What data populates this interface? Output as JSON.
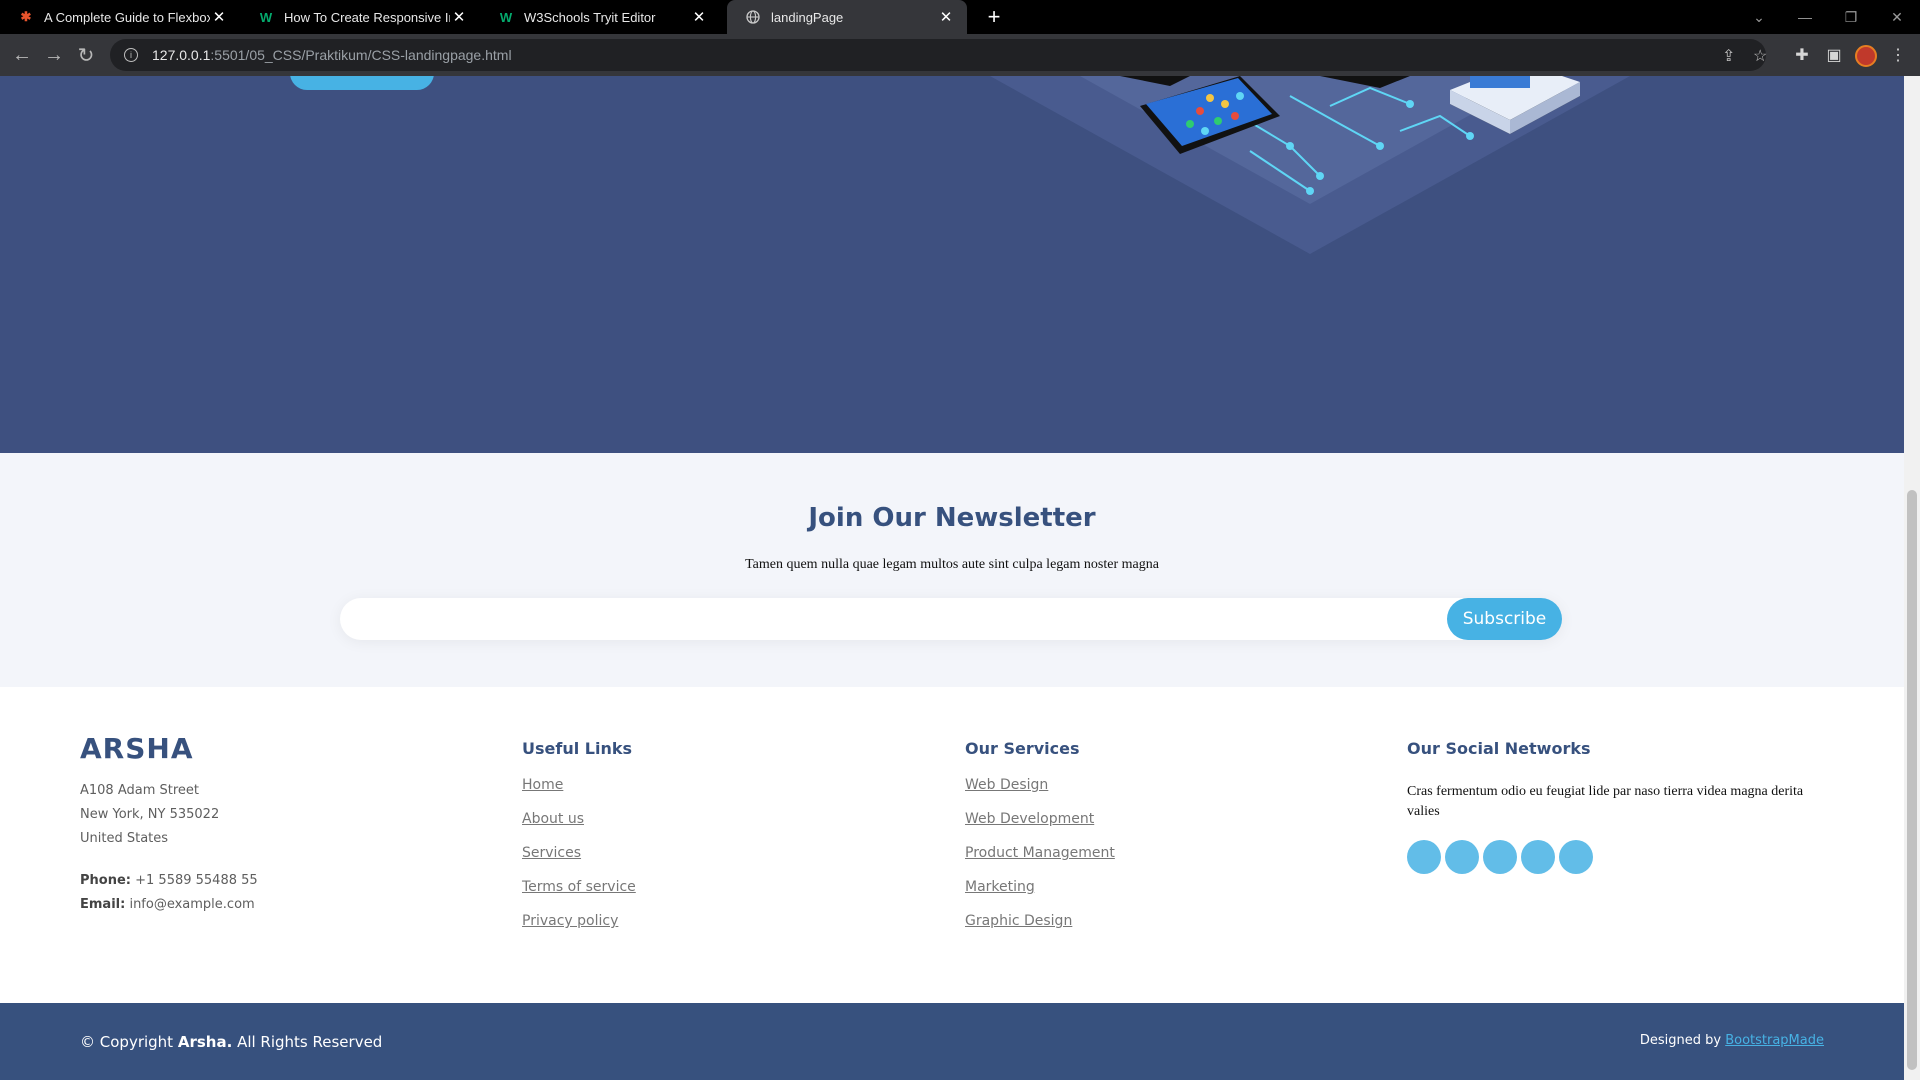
{
  "browser": {
    "tabs": [
      {
        "title": "A Complete Guide to Flexbox | C",
        "icon": "css-tricks-icon",
        "active": false
      },
      {
        "title": "How To Create Responsive Image",
        "icon": "w3schools-icon",
        "active": false
      },
      {
        "title": "W3Schools Tryit Editor",
        "icon": "w3schools-icon",
        "active": false
      },
      {
        "title": "landingPage",
        "icon": "globe-icon",
        "active": true
      }
    ],
    "new_tab": "+",
    "url_host": "127.0.0.1",
    "url_path": ":5501/05_CSS/Praktikum/CSS-landingpage.html"
  },
  "newsletter": {
    "title": "Join Our Newsletter",
    "text": "Tamen quem nulla quae legam multos aute sint culpa legam noster magna",
    "input_placeholder": "",
    "subscribe_label": "Subscribe"
  },
  "footer": {
    "brand": "ARSHA",
    "address": [
      "A108 Adam Street",
      "New York, NY 535022",
      "United States"
    ],
    "phone_label": "Phone:",
    "phone": "+1 5589 55488 55",
    "email_label": "Email:",
    "email": "info@example.com",
    "useful_links": {
      "title": "Useful Links",
      "items": [
        "Home",
        "About us",
        "Services",
        "Terms of service",
        "Privacy policy"
      ]
    },
    "services": {
      "title": "Our Services",
      "items": [
        "Web Design",
        "Web Development",
        "Product Management",
        "Marketing",
        "Graphic Design"
      ]
    },
    "social": {
      "title": "Our Social Networks",
      "text": "Cras fermentum odio eu feugiat lide par naso tierra videa magna derita valies",
      "buttons": [
        "social-1",
        "social-2",
        "social-3",
        "social-4",
        "social-5"
      ]
    },
    "copyright_prefix": "© Copyright",
    "copyright_brand": "Arsha.",
    "copyright_suffix": "All Rights Reserved",
    "credits_prefix": "Designed by",
    "credits_link": "BootstrapMade"
  },
  "colors": {
    "hero_bg": "#3e5080",
    "accent": "#47b2e4",
    "heading": "#37517e",
    "newsletter_bg": "#f3f5fa"
  }
}
